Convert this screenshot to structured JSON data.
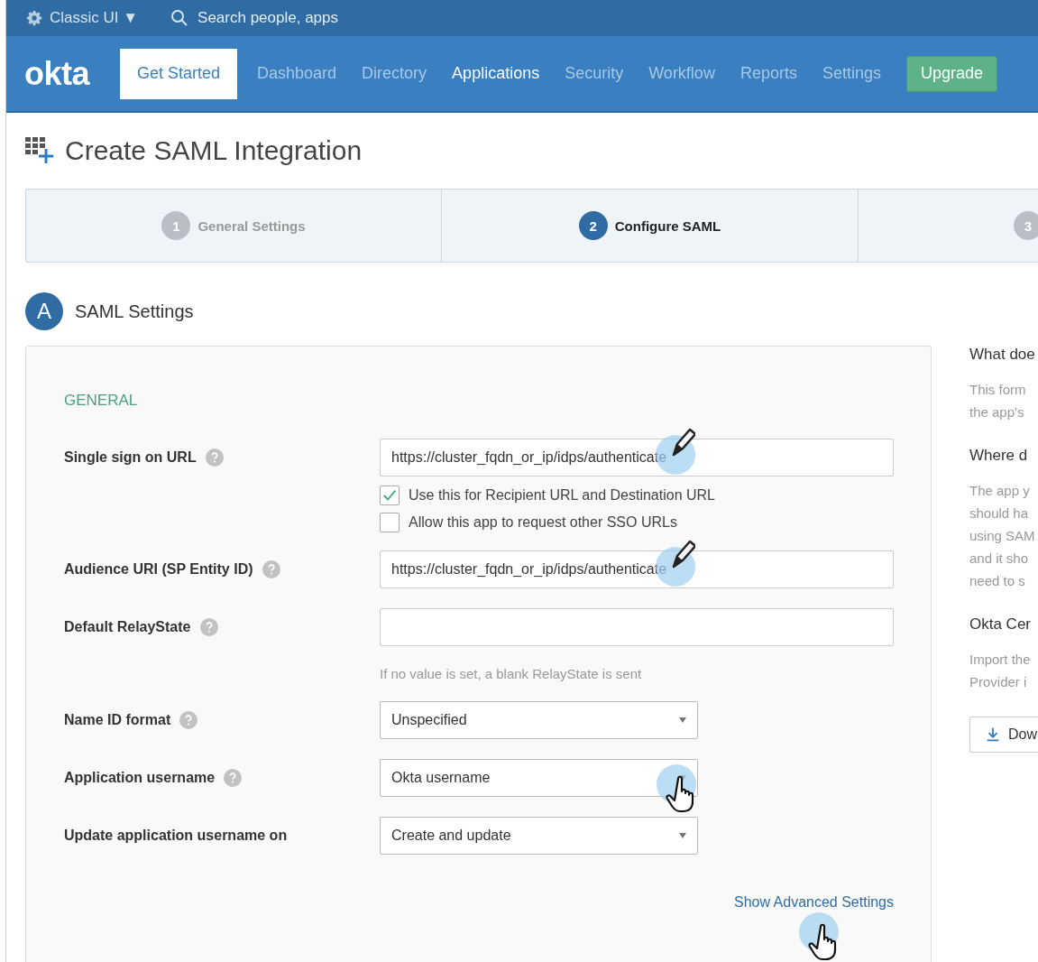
{
  "top_bar": {
    "ui_switch": "Classic UI ▼",
    "search_placeholder": "Search people, apps"
  },
  "nav": {
    "logo": "okta",
    "get_started": "Get Started",
    "items": [
      {
        "label": "Dashboard",
        "selected": false
      },
      {
        "label": "Directory",
        "selected": false
      },
      {
        "label": "Applications",
        "selected": true
      },
      {
        "label": "Security",
        "selected": false
      },
      {
        "label": "Workflow",
        "selected": false
      },
      {
        "label": "Reports",
        "selected": false
      },
      {
        "label": "Settings",
        "selected": false
      }
    ],
    "upgrade": "Upgrade"
  },
  "page_title": "Create SAML Integration",
  "steps": [
    {
      "number": "1",
      "label": "General Settings",
      "selected": false
    },
    {
      "number": "2",
      "label": "Configure SAML",
      "selected": true
    },
    {
      "number": "3",
      "selected": false
    }
  ],
  "section": {
    "badge": "A",
    "title": "SAML Settings"
  },
  "form": {
    "group": "GENERAL",
    "fields": [
      {
        "kind": "text",
        "label": "Single sign on URL",
        "help": true,
        "value": "https://cluster_fqdn_or_ip/idps/authenticate",
        "cursor": {
          "kind": "pencil"
        }
      },
      {
        "kind": "checkbox",
        "label": "Use this for Recipient URL and Destination URL",
        "checked": true
      },
      {
        "kind": "checkbox",
        "label": "Allow this app to request other SSO URLs",
        "checked": false
      },
      {
        "kind": "text",
        "label": "Audience URI (SP Entity ID)",
        "help": true,
        "value": "https://cluster_fqdn_or_ip/idps/authenticate",
        "cursor": {
          "kind": "pencil"
        }
      },
      {
        "kind": "text",
        "label": "Default RelayState",
        "help": true,
        "hint": "If no value is set, a blank RelayState is sent"
      },
      {
        "kind": "select",
        "label": "Name ID format",
        "help": true,
        "value": "Unspecified"
      },
      {
        "kind": "select",
        "label": "Application username",
        "help": true,
        "value": "Okta username",
        "cursor": {
          "kind": "hand"
        }
      },
      {
        "kind": "select",
        "label": "Update application username on",
        "help": false,
        "value": "Create and update"
      }
    ],
    "advanced_link": {
      "label": "Show Advanced Settings",
      "cursor": {
        "kind": "hand"
      }
    }
  },
  "sidebar": {
    "sections": [
      {
        "heading": "What doe",
        "lines": [
          "This form",
          "the app's"
        ]
      },
      {
        "heading": "Where d",
        "lines": [
          "The app y",
          "should ha",
          "using SAM",
          "and it sho",
          "need to s"
        ]
      },
      {
        "heading": "Okta Cer",
        "lines": [
          "Import the",
          "Provider i"
        ]
      }
    ],
    "download_button": "Dow"
  }
}
